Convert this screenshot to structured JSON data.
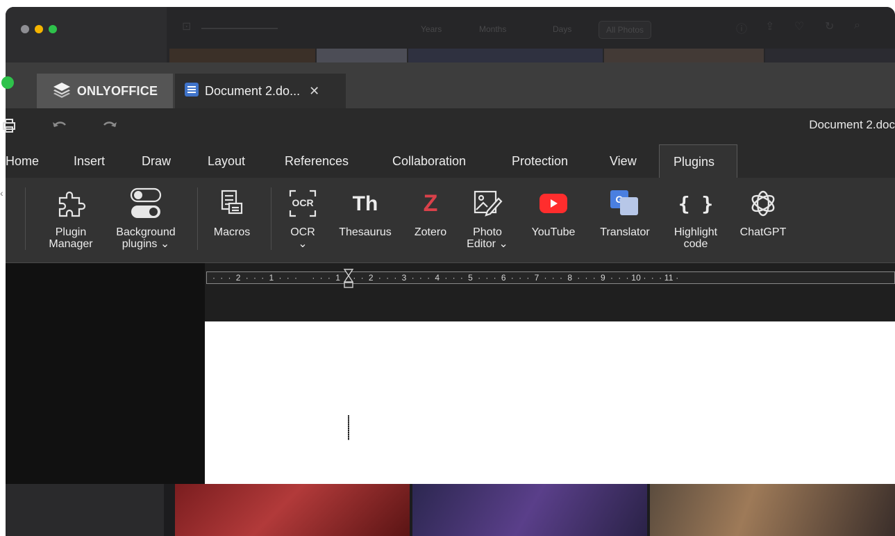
{
  "photos_app": {
    "view_tabs": [
      "Years",
      "Months",
      "Days",
      "All Photos"
    ],
    "selected_tab": "All Photos"
  },
  "tabs": {
    "app_tab_label": "ONLYOFFICE",
    "doc_tab_label": "Document 2.do...",
    "close_glyph": "✕"
  },
  "document_title": "Document 2.doc",
  "menu": [
    "Home",
    "Insert",
    "Draw",
    "Layout",
    "References",
    "Collaboration",
    "Protection",
    "View",
    "Plugins"
  ],
  "active_menu": "Plugins",
  "plugins": {
    "plugin_manager": [
      "Plugin",
      "Manager"
    ],
    "background_plugins": [
      "Background",
      "plugins ⌄"
    ],
    "macros": "Macros",
    "ocr": [
      "OCR",
      "⌄"
    ],
    "thesaurus": "Thesaurus",
    "zotero": "Zotero",
    "photo_editor": [
      "Photo",
      "Editor ⌄"
    ],
    "youtube": "YouTube",
    "translator": "Translator",
    "highlight_code": [
      "Highlight",
      "code"
    ],
    "chatgpt": "ChatGPT"
  },
  "icon_glyphs": {
    "thesaurus": "Th",
    "zotero": "Z",
    "ocr": "OCR",
    "highlight_code": "{ }",
    "translator": "G"
  },
  "ruler": {
    "labels": "·  ·  ·  2  ·  ·  ·  1  ·  ·  ·      ·  ·  ·  1  ·  ·  ·  2  ·  ·  ·  3  ·  ·  ·  4  ·  ·  ·  5  ·  ·  ·  6  ·  ·  ·  7  ·  ·  ·  8  ·  ·  ·  9  ·  ·  · 10 ·  ·  · 11 ·"
  },
  "colors": {
    "traffic_red": "#8e8e93",
    "traffic_yellow": "#f5b400",
    "traffic_green": "#2ec24b",
    "doc_icon_blue": "#3f73c9",
    "zotero_red": "#d9414a",
    "youtube_red": "#ff2d2d"
  }
}
